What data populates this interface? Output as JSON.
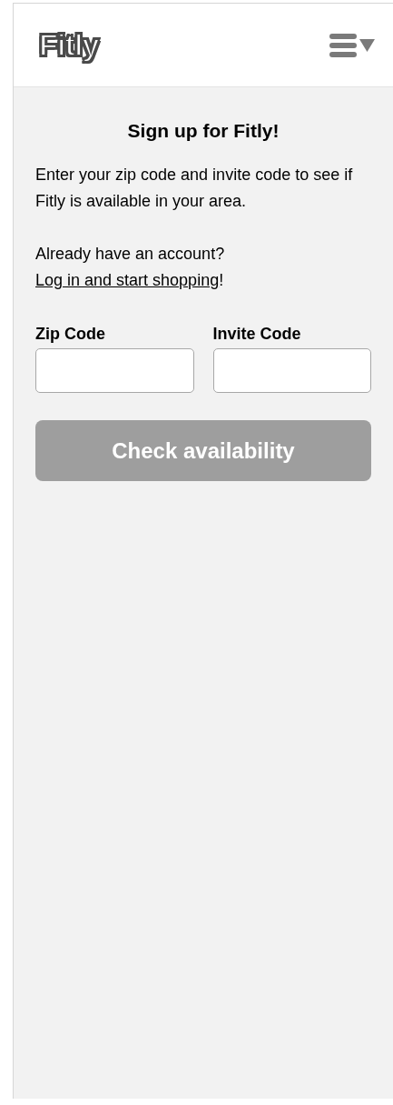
{
  "header": {
    "logo": "Fitly",
    "menu_expanded": false
  },
  "signup": {
    "title": "Sign up for Fitly!",
    "intro": "Enter your zip code and invite code to see if Fitly is available in your area.",
    "login_prompt": "Already have an account?",
    "login_link": "Log in and start shopping",
    "login_suffix": "!",
    "fields": [
      {
        "label": "Zip Code"
      },
      {
        "label": "Invite Code"
      }
    ],
    "submit": {
      "label": "Check availability",
      "disabled": true
    }
  }
}
